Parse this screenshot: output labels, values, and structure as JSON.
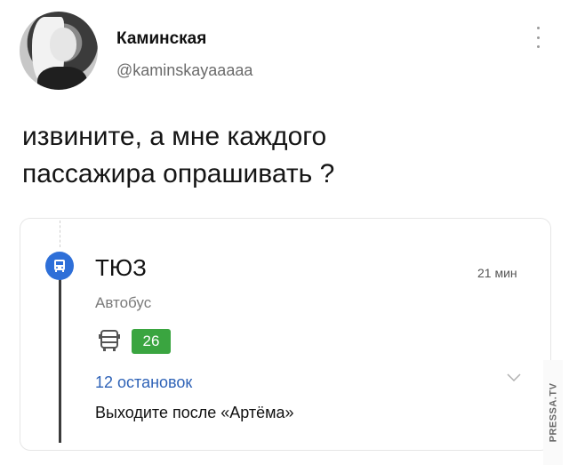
{
  "tweet": {
    "author_name": "Каминская",
    "author_handle": "@kaminskayaaaaa",
    "text_line1": "извините, а мне каждого",
    "text_line2": "пассажира опрашивать ?"
  },
  "card": {
    "stop_name": "ТЮЗ",
    "duration": "21 мин",
    "mode": "Автобус",
    "route_number": "26",
    "stops_count": "12 остановок",
    "exit_instruction": "Выходите после «Артёма»",
    "accent_color": "#2e6fd8",
    "route_badge_color": "#3aa540",
    "link_color": "#2f63b7"
  },
  "watermark": {
    "text": "PRESSA.TV"
  },
  "icons": [
    "more-vertical-icon",
    "bus-icon",
    "bus-small-icon",
    "chevron-down-icon"
  ]
}
